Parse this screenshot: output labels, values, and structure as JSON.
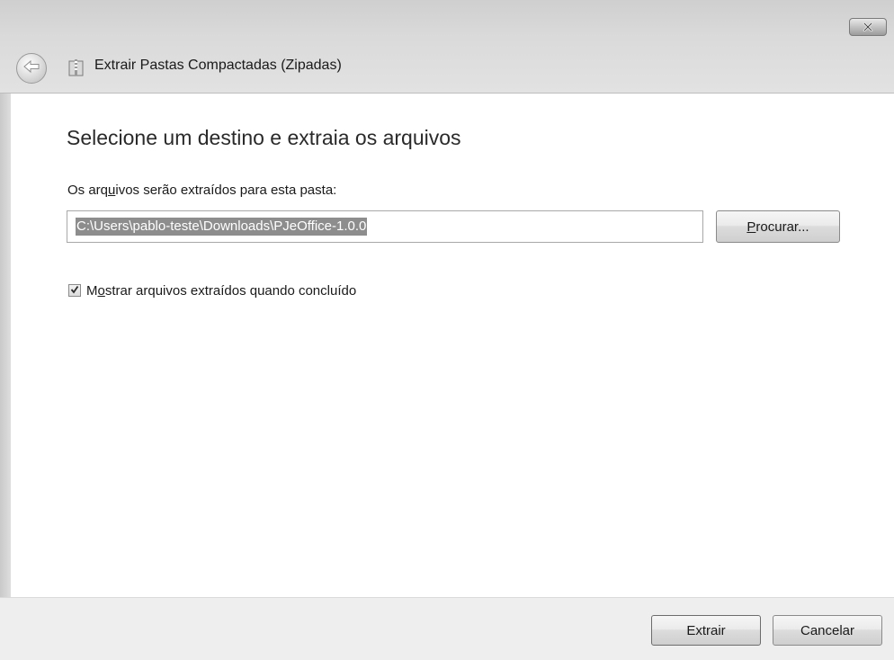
{
  "window": {
    "title": "Extrair Pastas Compactadas (Zipadas)",
    "close_icon": "close-icon",
    "back_icon": "back-arrow-icon",
    "app_icon": "zip-folder-icon"
  },
  "main": {
    "heading": "Selecione um destino e extraia os arquivos",
    "destination_label_parts": [
      "Os arq",
      "u",
      "ivos serão extraídos para esta pasta:"
    ],
    "destination_path": "C:\\Users\\pablo-teste\\Downloads\\PJeOffice-1.0.0",
    "browse_label_parts": [
      "",
      "P",
      "rocurar..."
    ],
    "show_files_checkbox": {
      "checked": true,
      "label_parts": [
        "M",
        "o",
        "strar arquivos extraídos quando concluído"
      ]
    }
  },
  "footer": {
    "extract_label": "Extrair",
    "cancel_label": "Cancelar"
  }
}
